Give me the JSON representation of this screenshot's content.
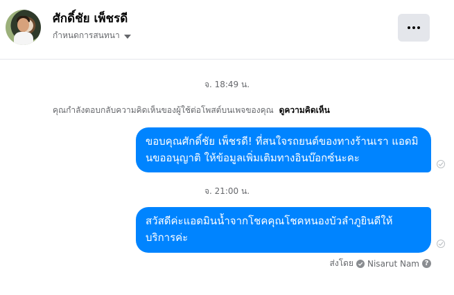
{
  "header": {
    "contact_name": "ศักดิ์ชัย เพ็ชรดี",
    "subtitle": "กำหนดการสนทนา",
    "more_icon": "more-horizontal-icon"
  },
  "conversation": {
    "timestamps": [
      "จ. 18:49 น.",
      "จ. 21:00 น."
    ],
    "context_text": "คุณกำลังตอบกลับความคิดเห็นของผู้ใช้ต่อโพสต์บนเพจของคุณ",
    "context_link": "ดูความคิดเห็น",
    "messages": [
      {
        "text": "ขอบคุณศักดิ์ชัย เพ็ชรดี! ที่สนใจรถยนต์ของทางร้านเรา แอดมินขออนุญาติ ให้ข้อมูลเพิ่มเติมทางอินบ๊อกซ์นะคะ"
      },
      {
        "text": "สวัสดีค่ะแอดมินน้ำจากโชคคุณโชคหนองบัวลำภูยินดีให้บริการค่ะ"
      }
    ],
    "sent_by_label": "ส่งโดย",
    "sent_by_name": "Nisarut Nam",
    "bubble_color": "#0084ff"
  }
}
